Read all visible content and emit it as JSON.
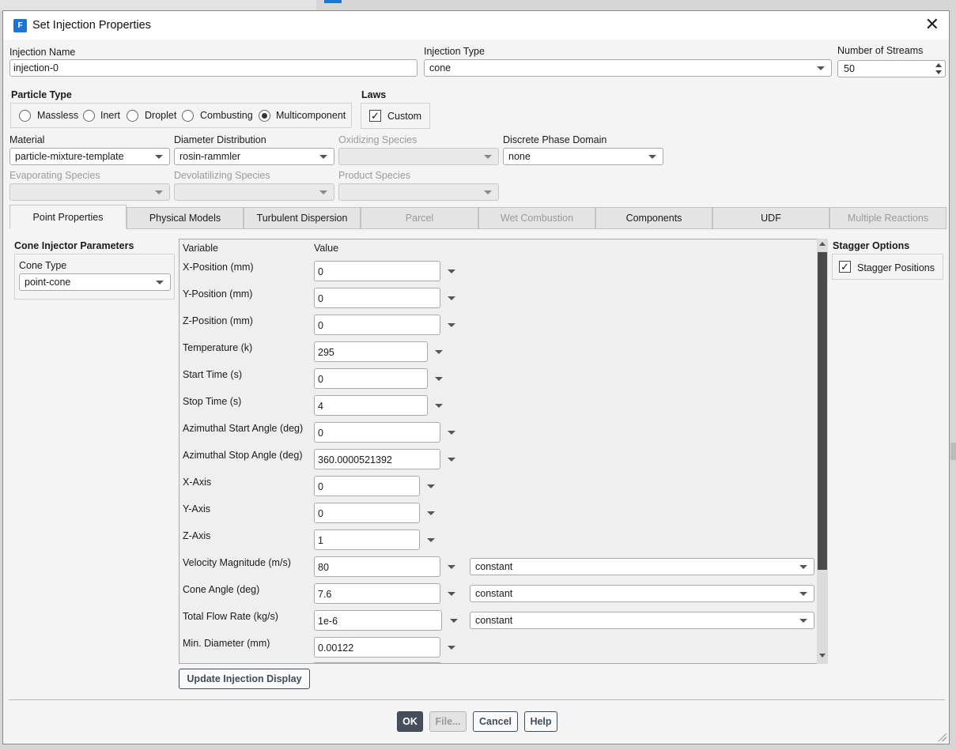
{
  "window": {
    "title": "Set Injection Properties",
    "icon": "fluent-app-icon"
  },
  "injection_name": {
    "label": "Injection Name",
    "value": "injection-0"
  },
  "injection_type": {
    "label": "Injection Type",
    "value": "cone"
  },
  "number_of_streams": {
    "label": "Number of Streams",
    "value": "50"
  },
  "particle_type": {
    "label": "Particle Type",
    "options": [
      "Massless",
      "Inert",
      "Droplet",
      "Combusting",
      "Multicomponent"
    ],
    "selected": "Multicomponent"
  },
  "laws": {
    "label": "Laws",
    "custom_label": "Custom",
    "custom_checked": true
  },
  "material": {
    "label": "Material",
    "value": "particle-mixture-template"
  },
  "diameter_distribution": {
    "label": "Diameter Distribution",
    "value": "rosin-rammler"
  },
  "oxidizing_species": {
    "label": "Oxidizing Species",
    "value": ""
  },
  "discrete_phase_domain": {
    "label": "Discrete Phase Domain",
    "value": "none"
  },
  "evaporating_species": {
    "label": "Evaporating Species",
    "value": ""
  },
  "devolatilizing_species": {
    "label": "Devolatilizing Species",
    "value": ""
  },
  "product_species": {
    "label": "Product Species",
    "value": ""
  },
  "tabs": [
    {
      "label": "Point Properties",
      "active": true,
      "enabled": true
    },
    {
      "label": "Physical Models",
      "active": false,
      "enabled": true
    },
    {
      "label": "Turbulent Dispersion",
      "active": false,
      "enabled": true
    },
    {
      "label": "Parcel",
      "active": false,
      "enabled": false
    },
    {
      "label": "Wet Combustion",
      "active": false,
      "enabled": false
    },
    {
      "label": "Components",
      "active": false,
      "enabled": true
    },
    {
      "label": "UDF",
      "active": false,
      "enabled": true
    },
    {
      "label": "Multiple Reactions",
      "active": false,
      "enabled": false
    }
  ],
  "cone_injector": {
    "title": "Cone Injector Parameters",
    "cone_type_label": "Cone Type",
    "cone_type_value": "point-cone"
  },
  "properties_table": {
    "header_variable": "Variable",
    "header_value": "Value",
    "rows": [
      {
        "label": "X-Position (mm)",
        "value": "0"
      },
      {
        "label": "Y-Position (mm)",
        "value": "0"
      },
      {
        "label": "Z-Position (mm)",
        "value": "0"
      },
      {
        "label": "Temperature (k)",
        "value": "295"
      },
      {
        "label": "Start Time (s)",
        "value": "0"
      },
      {
        "label": "Stop Time (s)",
        "value": "4"
      },
      {
        "label": "Azimuthal Start Angle (deg)",
        "value": "0"
      },
      {
        "label": "Azimuthal Stop Angle (deg)",
        "value": "360.0000521392"
      },
      {
        "label": "X-Axis",
        "value": "0"
      },
      {
        "label": "Y-Axis",
        "value": "0"
      },
      {
        "label": "Z-Axis",
        "value": "1"
      },
      {
        "label": "Velocity Magnitude (m/s)",
        "value": "80",
        "profile": "constant"
      },
      {
        "label": "Cone Angle (deg)",
        "value": "7.6",
        "profile": "constant"
      },
      {
        "label": "Total Flow Rate (kg/s)",
        "value": "1e-6",
        "profile": "constant"
      },
      {
        "label": "Min. Diameter (mm)",
        "value": "0.00122"
      }
    ]
  },
  "update_button": "Update Injection Display",
  "stagger": {
    "title": "Stagger Options",
    "positions_label": "Stagger Positions",
    "positions_checked": true
  },
  "buttons": {
    "ok": "OK",
    "file": "File...",
    "cancel": "Cancel",
    "help": "Help"
  }
}
